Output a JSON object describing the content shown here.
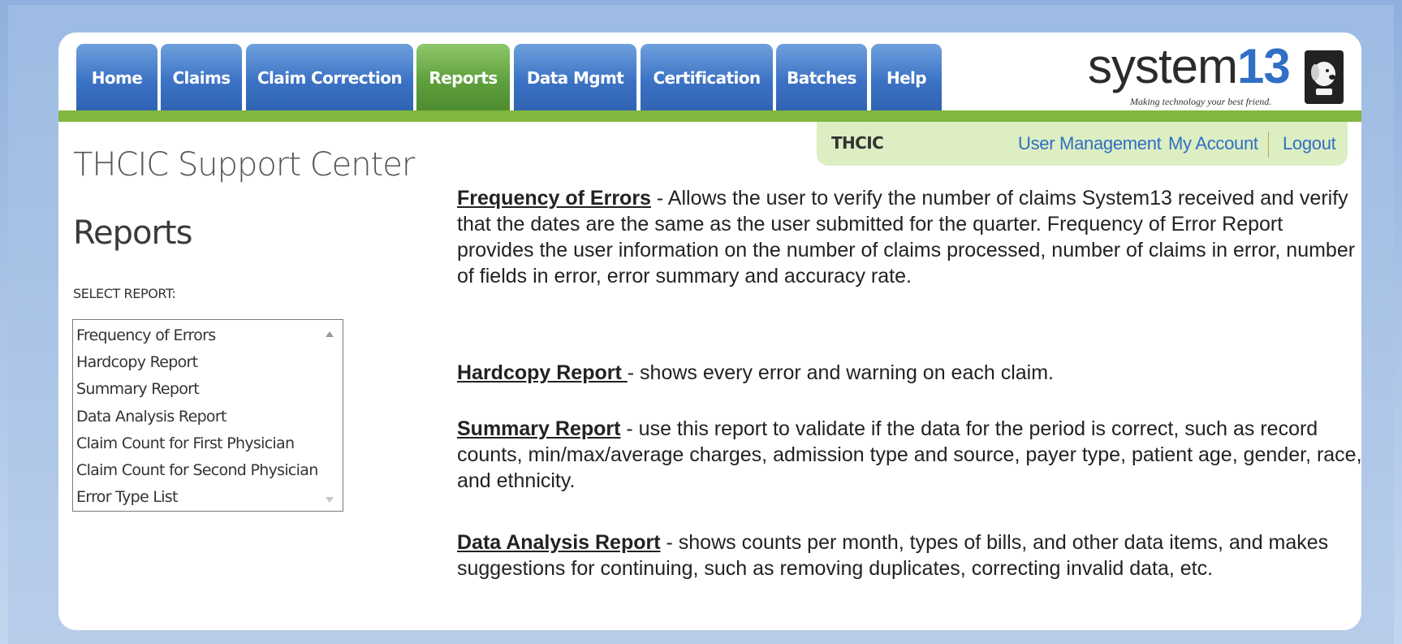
{
  "nav": {
    "tabs": [
      {
        "label": "Home",
        "active": false
      },
      {
        "label": "Claims",
        "active": false
      },
      {
        "label": "Claim Correction",
        "active": false
      },
      {
        "label": "Reports",
        "active": true
      },
      {
        "label": "Data Mgmt",
        "active": false
      },
      {
        "label": "Certification",
        "active": false
      },
      {
        "label": "Batches",
        "active": false
      },
      {
        "label": "Help",
        "active": false
      }
    ]
  },
  "brand": {
    "name_text": "system",
    "name_number": "13",
    "tagline": "Making technology your best friend.",
    "icon": "dog-icon",
    "color_tabs": "#3c72c4",
    "color_active": "#5f9f3c",
    "color_bar": "#82b63e"
  },
  "account": {
    "org": "THCIC",
    "user_management": "User Management",
    "my_account": "My Account",
    "logout": "Logout"
  },
  "sidebar": {
    "site_title": "THCIC Support Center",
    "heading": "Reports",
    "select_label": "SELECT REPORT:",
    "reports": [
      "Frequency of Errors",
      "Hardcopy Report",
      "Summary Report",
      "Data Analysis Report",
      "Claim Count for First Physician",
      "Claim Count for Second Physician",
      "Error Type List"
    ]
  },
  "descriptions": [
    {
      "term": "Frequency of Errors",
      "text": " - Allows the user to verify the number of claims System13 received and verify that the dates are the same as the user submitted for the quarter. Frequency of Error Report provides the user information on the number of claims processed, number of claims in error, number of fields in error, error summary and accuracy rate."
    },
    {
      "term": "Hardcopy Report ",
      "text": "- shows every error and warning on each claim."
    },
    {
      "term": "Summary Report",
      "text": " - use this report to validate if the data for the period is correct, such as record counts, min/max/average charges, admission type and source, payer type, patient age, gender, race, and ethnicity."
    },
    {
      "term": "Data Analysis Report",
      "text": " - shows counts per month, types of bills, and other data items, and makes suggestions for continuing, such as removing duplicates, correcting invalid data, etc."
    }
  ]
}
